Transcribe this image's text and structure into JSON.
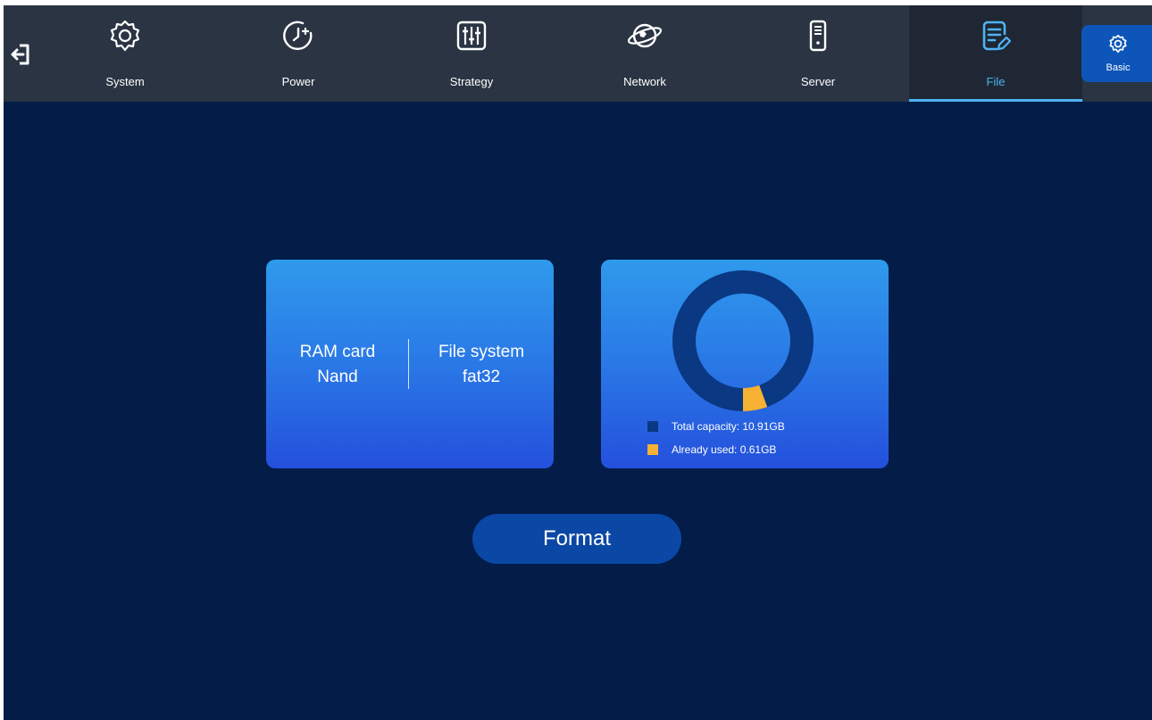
{
  "nav": {
    "tabs": [
      {
        "label": "System",
        "icon": "gear-icon"
      },
      {
        "label": "Power",
        "icon": "clock-power-icon"
      },
      {
        "label": "Strategy",
        "icon": "sliders-icon"
      },
      {
        "label": "Network",
        "icon": "globe-icon"
      },
      {
        "label": "Server",
        "icon": "server-icon"
      },
      {
        "label": "File",
        "icon": "file-icon",
        "active": true
      }
    ],
    "back_icon": "exit-icon",
    "basic_label": "Basic"
  },
  "storage_info": {
    "ram_title": "RAM card",
    "ram_value": "Nand",
    "fs_title": "File system",
    "fs_value": "fat32"
  },
  "capacity": {
    "total_label": "Total capacity: 10.91GB",
    "used_label": "Already used: 0.61GB",
    "total_gb": 10.91,
    "used_gb": 0.61,
    "total_color": "#0a3882",
    "used_color": "#f7b134"
  },
  "actions": {
    "format_label": "Format"
  }
}
